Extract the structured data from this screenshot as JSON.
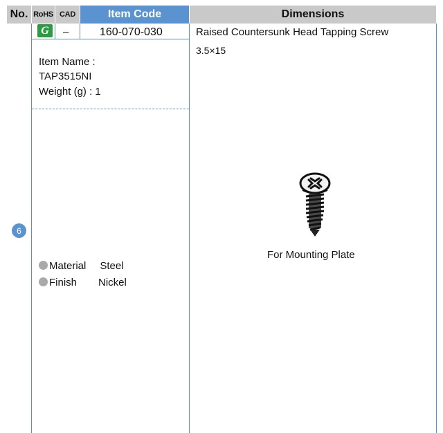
{
  "header": {
    "no": "No.",
    "rohs": "RoHS",
    "cad": "CAD",
    "item_code": "Item Code",
    "dimensions": "Dimensions"
  },
  "row": {
    "number": "6",
    "rohs_badge": "G",
    "cad": "–",
    "item_code": "160-070-030",
    "item_name_label": "Item Name :",
    "item_name_value": "TAP3515NI",
    "weight": "Weight (g) : 1",
    "material_label": "Material",
    "material_value": "Steel",
    "finish_label": "Finish",
    "finish_value": "Nickel",
    "description": "Raised Countersunk Head Tapping Screw",
    "size": "3.5×15",
    "caption": "For Mounting Plate"
  },
  "colors": {
    "header_gray": "#c9c9c9",
    "header_blue": "#5b93d1",
    "grid_line": "#5b8fcc",
    "rohs_green": "#2e9a44",
    "bullet_gray": "#a9a9a9"
  }
}
